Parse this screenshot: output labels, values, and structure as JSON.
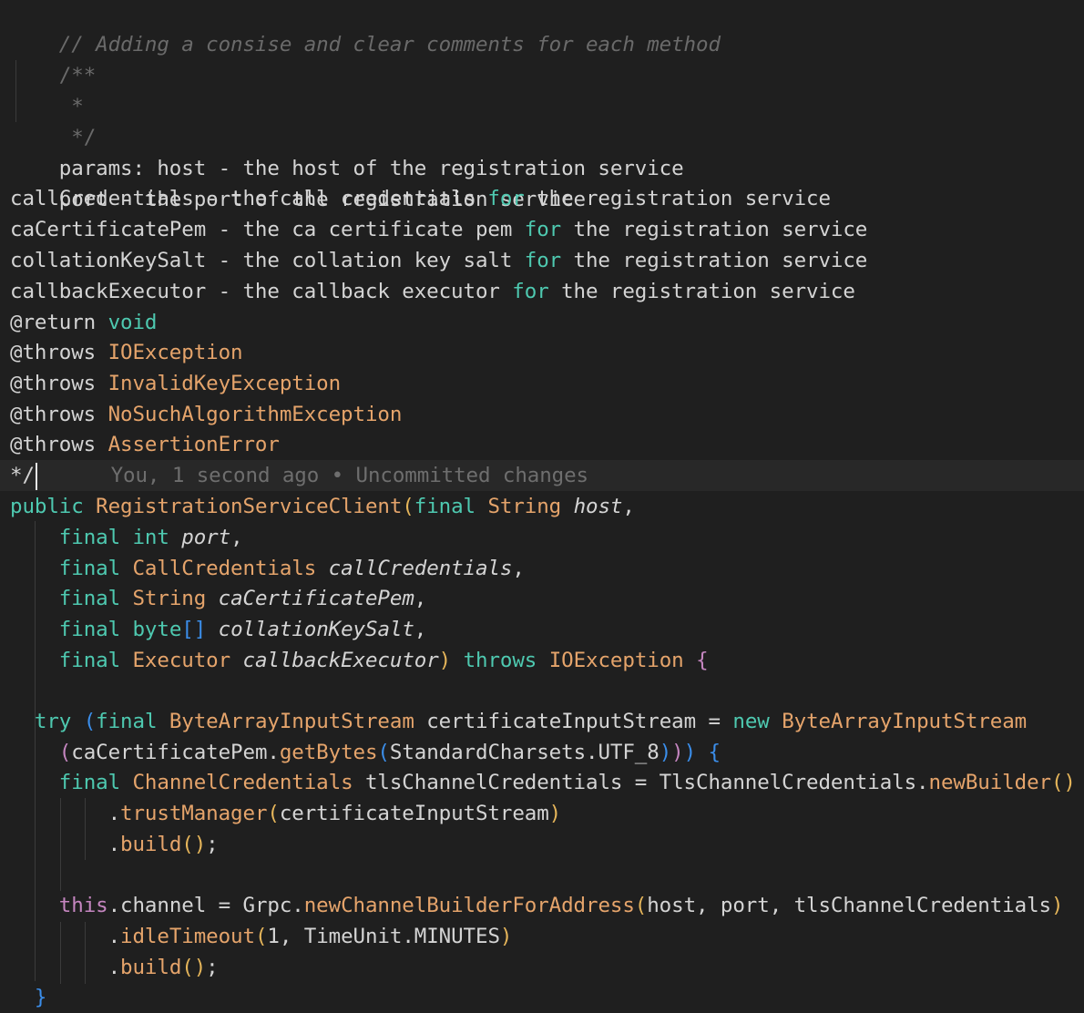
{
  "colors": {
    "background": "#1f1f1f",
    "current_line": "#282828",
    "comment": "#6a6a6a",
    "keyword": "#4ec9b0",
    "type": "#e5a46b",
    "bracket_gold": "#e5b55a",
    "bracket_purple": "#c586c0",
    "bracket_blue": "#3b8eea"
  },
  "code": {
    "line1": "// Adding a consise and clear comments for each method",
    "line2": "/**",
    "line3": " *",
    "line4": " */",
    "line5": {
      "a": "params: host - the host of the registration service"
    },
    "line6": "port - the port of the registration service",
    "line7": {
      "a": "callCredentials - the call credentials ",
      "kw": "for",
      "b": " the registration service"
    },
    "line8": {
      "a": "caCertificatePem - the ca certificate pem ",
      "kw": "for",
      "b": " the registration service"
    },
    "line9": {
      "a": "collationKeySalt - the collation key salt ",
      "kw": "for",
      "b": " the registration service"
    },
    "line10": {
      "a": "callbackExecutor - the callback executor ",
      "kw": "for",
      "b": " the registration service"
    },
    "line11": {
      "tag": "@return",
      "val": "void"
    },
    "line12": {
      "tag": "@throws",
      "val": "IOException"
    },
    "line13": {
      "tag": "@throws",
      "val": "InvalidKeyException"
    },
    "line14": {
      "tag": "@throws",
      "val": "NoSuchAlgorithmException"
    },
    "line15": {
      "tag": "@throws",
      "val": "AssertionError"
    },
    "line16": {
      "a": "*/",
      "blame": "You, 1 second ago • Uncommitted changes"
    },
    "line17": {
      "kw": "public",
      "name": "RegistrationServiceClient",
      "p1": "(",
      "fin": "final",
      "type": "String",
      "param": "host",
      "tail": ","
    },
    "line18": {
      "fin": "final",
      "type": "int",
      "param": "port",
      "tail": ","
    },
    "line19": {
      "fin": "final",
      "type": "CallCredentials",
      "param": "callCredentials",
      "tail": ","
    },
    "line20": {
      "fin": "final",
      "type": "String",
      "param": "caCertificatePem",
      "tail": ","
    },
    "line21": {
      "fin": "final",
      "type": "byte",
      "arr": "[]",
      "param": "collationKeySalt",
      "tail": ","
    },
    "line22": {
      "fin": "final",
      "type": "Executor",
      "param": "callbackExecutor",
      "close": ")",
      "throws": "throws",
      "ex": "IOException",
      "brace": "{"
    },
    "line24": {
      "try": "try",
      "p": "(",
      "fin": "final",
      "type": "ByteArrayInputStream",
      "var": " certificateInputStream = ",
      "new": "new",
      "type2": "ByteArrayInputStream"
    },
    "line25": {
      "p1": "(",
      "a": "caCertificatePem.",
      "m": "getBytes",
      "p2": "(",
      "b": "StandardCharsets.UTF_8",
      "p3": ")",
      "p4": ")",
      "p5": ")",
      "brace": "{"
    },
    "line26": {
      "fin": "final",
      "type": "ChannelCredentials",
      "var": " tlsChannelCredentials = TlsChannelCredentials.",
      "m": "newBuilder",
      "p": "()"
    },
    "line27": {
      "dot": ".",
      "m": "trustManager",
      "p1": "(",
      "a": "certificateInputStream",
      "p2": ")"
    },
    "line28": {
      "dot": ".",
      "m": "build",
      "p": "()",
      "semi": ";"
    },
    "line30": {
      "this": "this",
      "a": ".channel = Grpc.",
      "m": "newChannelBuilderForAddress",
      "p1": "(",
      "b": "host, port, tlsChannelCredentials",
      "p2": ")"
    },
    "line31": {
      "dot": ".",
      "m": "idleTimeout",
      "p1": "(",
      "n": "1",
      "b": ", TimeUnit.MINUTES",
      "p2": ")"
    },
    "line32": {
      "dot": ".",
      "m": "build",
      "p": "()",
      "semi": ";"
    },
    "line33": {
      "brace": "}"
    }
  }
}
